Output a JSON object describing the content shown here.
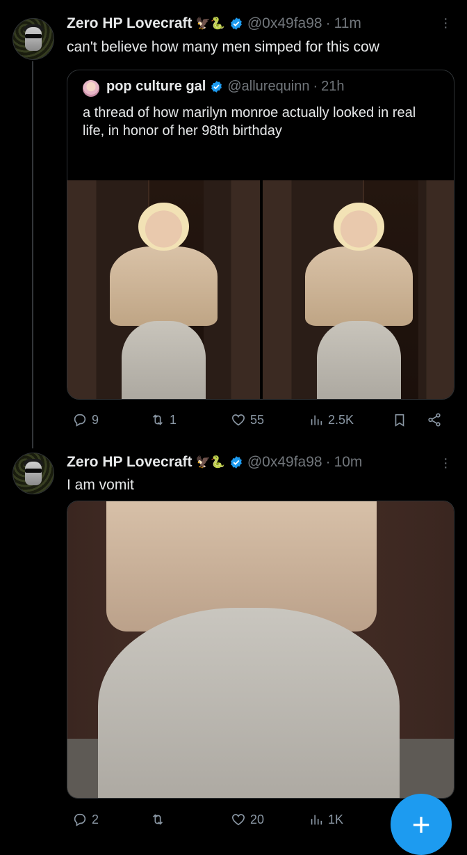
{
  "tweet1": {
    "name": "Zero HP Lovecraft",
    "emojis": "🦅🐍",
    "handle": "@0x49fa98",
    "separator": "·",
    "time": "11m",
    "text": "can't believe how many men simped for this cow",
    "quote": {
      "name": "pop culture gal",
      "handle": "@allurequinn",
      "separator": "·",
      "time": "21h",
      "text": "a thread of how marilyn monroe actually looked in real life, in honor of her 98th birthday"
    },
    "actions": {
      "replies": "9",
      "reposts": "1",
      "likes": "55",
      "views": "2.5K"
    }
  },
  "tweet2": {
    "name": "Zero HP Lovecraft",
    "emojis": "🦅🐍",
    "handle": "@0x49fa98",
    "separator": "·",
    "time": "10m",
    "text": "I am vomit",
    "actions": {
      "replies": "2",
      "reposts": "",
      "likes": "20",
      "views": "1K"
    }
  },
  "fab": {
    "label": "+"
  },
  "colors": {
    "accent": "#1d9bf0",
    "muted": "#71767b",
    "background": "#000000"
  }
}
